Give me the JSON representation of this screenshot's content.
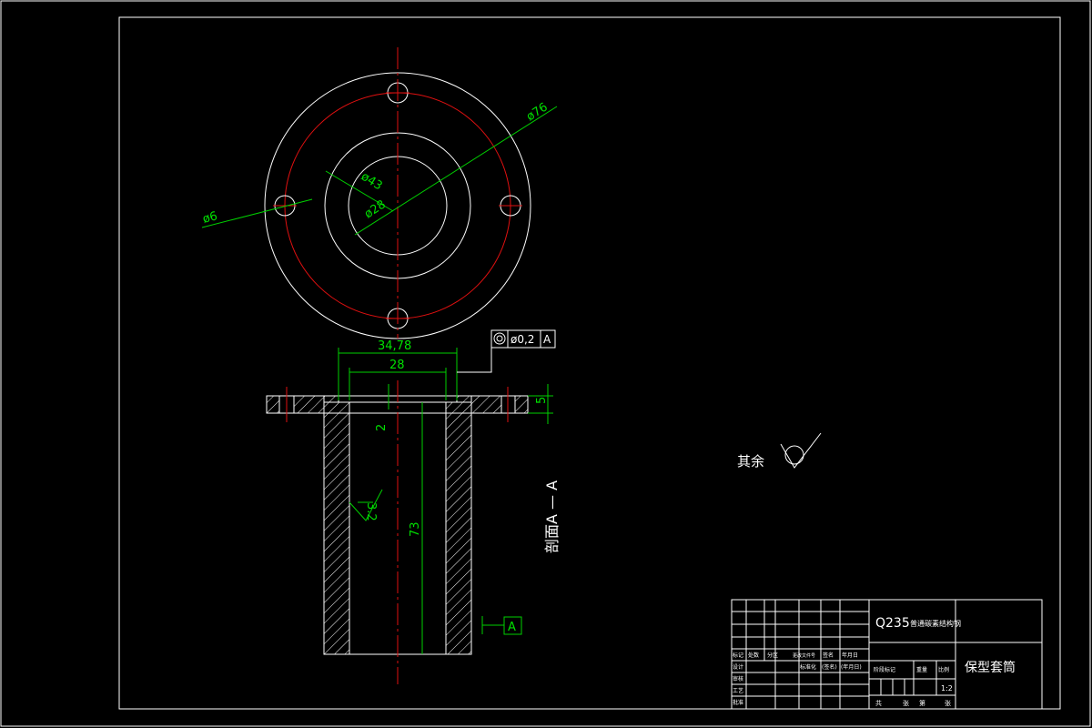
{
  "dimensions": {
    "outer_dia": "ø76",
    "mid_dia": "ø43",
    "inner_dia": "ø28",
    "hole_dia": "ø6",
    "flange_width": "34,78",
    "bore_width": "28",
    "flange_thickness": "5",
    "step_depth": "2",
    "body_length": "73",
    "roughness_symbol": "3.2",
    "tolerance_value": "ø0,2",
    "datum_ref": "A",
    "datum_label": "A"
  },
  "annotations": {
    "section_label": "剖面A — A",
    "remaining_roughness": "其余"
  },
  "title_block": {
    "material": "Q235",
    "material_desc": "普通碳素结构钢",
    "part_name": "保型套筒",
    "scale": "1:2",
    "row_labels": [
      "标记",
      "处数",
      "分区",
      "更改文件号",
      "签名",
      "年月日"
    ],
    "left_rows": [
      "设计",
      "审核",
      "工艺",
      "批准"
    ],
    "mid_labels": [
      "标准化",
      "(签名)",
      "(年月日)"
    ],
    "stage_label": "阶段标记",
    "weight_label": "重量",
    "ratio_label": "比例",
    "sheet_text": [
      "共",
      "张",
      "第",
      "张"
    ]
  },
  "colors": {
    "outline": "#ffffff",
    "center_line": "#e01010",
    "dimension": "#00d000",
    "background": "#000000"
  }
}
